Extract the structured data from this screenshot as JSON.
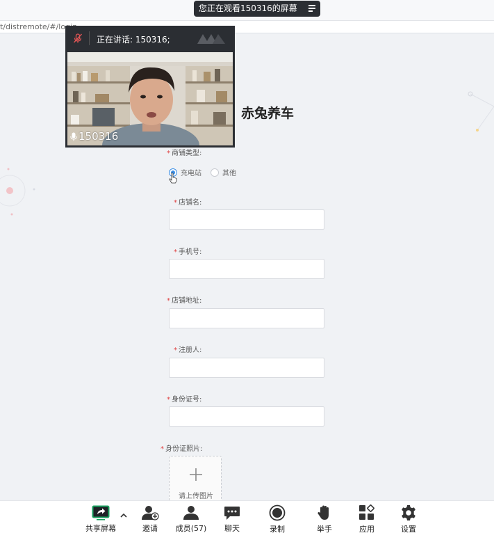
{
  "banner": {
    "text": "您正在观看150316的屏幕",
    "menu_icon": "menu-icon"
  },
  "address": {
    "url": "t/distremote/#/login"
  },
  "video": {
    "speaking_label": "正在讲话: 150316;",
    "participant_name": "150316"
  },
  "form": {
    "title": "赤兔养车",
    "shop_type_label": "商铺类型:",
    "shop_type_options": [
      {
        "label": "充电站",
        "checked": true
      },
      {
        "label": "其他",
        "checked": false
      }
    ],
    "fields": [
      {
        "label": "店铺名:",
        "value": ""
      },
      {
        "label": "手机号:",
        "value": ""
      },
      {
        "label": "店铺地址:",
        "value": ""
      },
      {
        "label": "注册人:",
        "value": ""
      },
      {
        "label": "身份证号:",
        "value": ""
      }
    ],
    "id_photo_label": "身份证照片:",
    "upload_label": "请上传图片"
  },
  "toolbar": {
    "share_screen": "共享屏幕",
    "invite": "邀请",
    "members": "成员(57)",
    "chat": "聊天",
    "record": "录制",
    "raise_hand": "举手",
    "apps": "应用",
    "settings": "设置"
  },
  "colors": {
    "accent": "#3a8ee6",
    "required": "#e04040",
    "share_green": "#1aa260",
    "dark_panel": "#2b2e33"
  }
}
